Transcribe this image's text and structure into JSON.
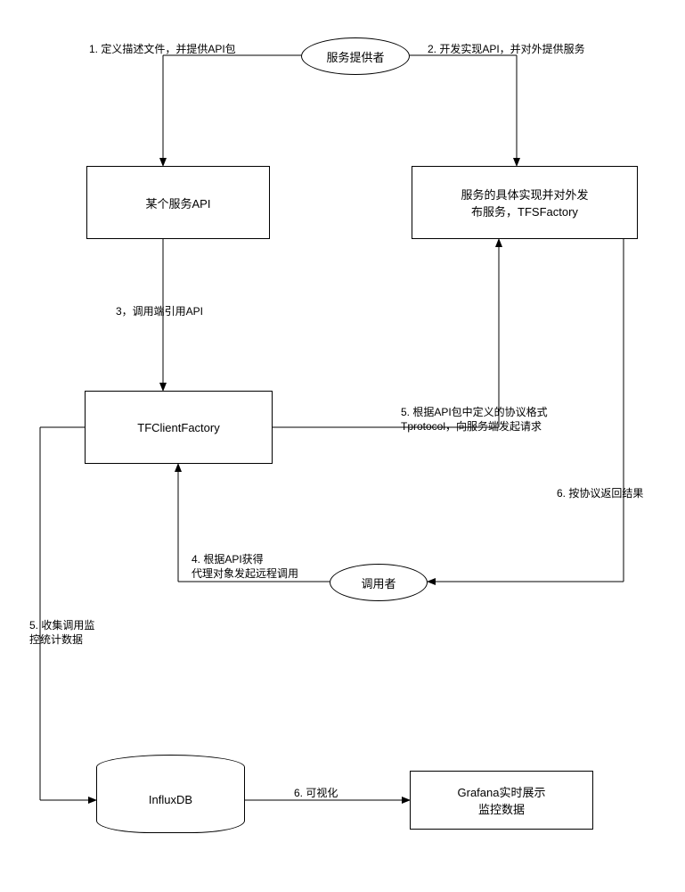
{
  "nodes": {
    "provider": "服务提供者",
    "api": "某个服务API",
    "impl": "服务的具体实现并对外发\n布服务，TFSFactory",
    "client": "TFClientFactory",
    "caller": "调用者",
    "influx": "InfluxDB",
    "grafana": "Grafana实时展示\n监控数据"
  },
  "edges": {
    "e1": "1. 定义描述文件，并提供API包",
    "e2": "2. 开发实现API，并对外提供服务",
    "e3": "3，调用端引用API",
    "e4": "4. 根据API获得\n代理对象发起远程调用",
    "e5a": "5. 根据API包中定义的协议格式\nTprotocol，向服务端发起请求",
    "e5b": "5. 收集调用监\n控统计数据",
    "e6a": "6. 按协议返回结果",
    "e6b": "6. 可视化"
  }
}
